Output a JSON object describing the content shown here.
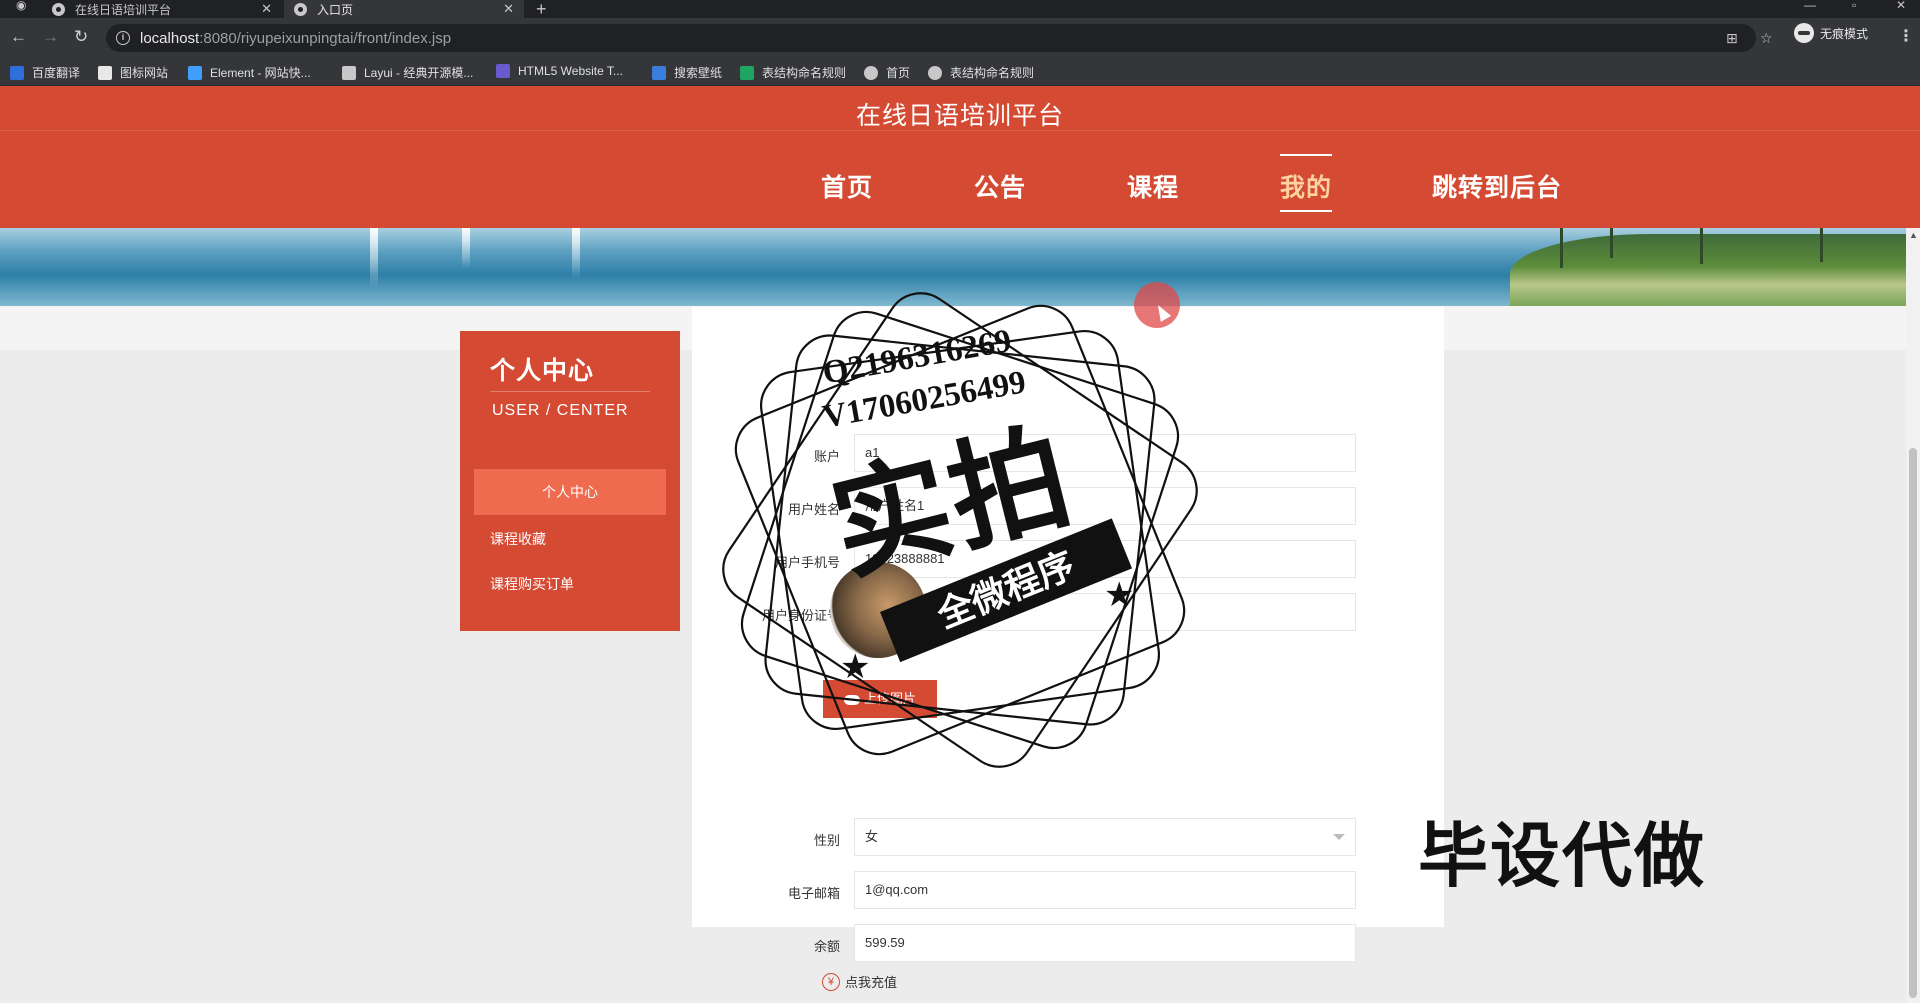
{
  "browser": {
    "tabs": [
      {
        "title": "在线日语培训平台"
      },
      {
        "title": "入口页"
      }
    ],
    "url_host": "localhost",
    "url_rest": ":8080/riyupeixunpingtai/front/index.jsp",
    "incognito_label": "无痕模式",
    "bookmarks": [
      {
        "label": "百度翻译",
        "color": "#2e6fdc"
      },
      {
        "label": "图标网站",
        "color": "#e8e8e8"
      },
      {
        "label": "Element - 网站快...",
        "color": "#409eff"
      },
      {
        "label": "Layui - 经典开源模...",
        "color": "#c8c8c8"
      },
      {
        "label": "HTML5 Website T...",
        "color": "#6a5acd"
      },
      {
        "label": "搜索壁纸",
        "color": "#3b7ddd"
      },
      {
        "label": "表结构命名规则",
        "color": "#1fa463"
      },
      {
        "label": "首页",
        "color": "#c8c8c8"
      },
      {
        "label": "表结构命名规则",
        "color": "#c8c8c8"
      }
    ]
  },
  "site": {
    "title": "在线日语培训平台",
    "nav": [
      {
        "label": "首页"
      },
      {
        "label": "公告"
      },
      {
        "label": "课程"
      },
      {
        "label": "我的"
      },
      {
        "label": "跳转到后台"
      }
    ],
    "accent_color": "#d44a33"
  },
  "sidebar": {
    "title": "个人中心",
    "subtitle": "USER / CENTER",
    "items": [
      {
        "label": "个人中心"
      },
      {
        "label": "课程收藏"
      },
      {
        "label": "课程购买订单"
      }
    ]
  },
  "form": {
    "fields": [
      {
        "label": "账户",
        "value": "a1"
      },
      {
        "label": "用户姓名",
        "value": "用户姓名1"
      },
      {
        "label": "用户手机号",
        "value": "13823888881"
      },
      {
        "label": "用户身份证号",
        "value": "410224199610232001"
      }
    ],
    "upload_label": "上传图片",
    "gender": {
      "label": "性别",
      "value": "女"
    },
    "email": {
      "label": "电子邮箱",
      "value": "1@qq.com"
    },
    "balance": {
      "label": "余额",
      "value": "599.59"
    },
    "recharge_label": "点我充值"
  },
  "watermark": {
    "line1": "Q2196316269",
    "line2": "V17060256499",
    "big": "实拍",
    "ribbon": "全微程序",
    "corner": "毕设代做"
  }
}
